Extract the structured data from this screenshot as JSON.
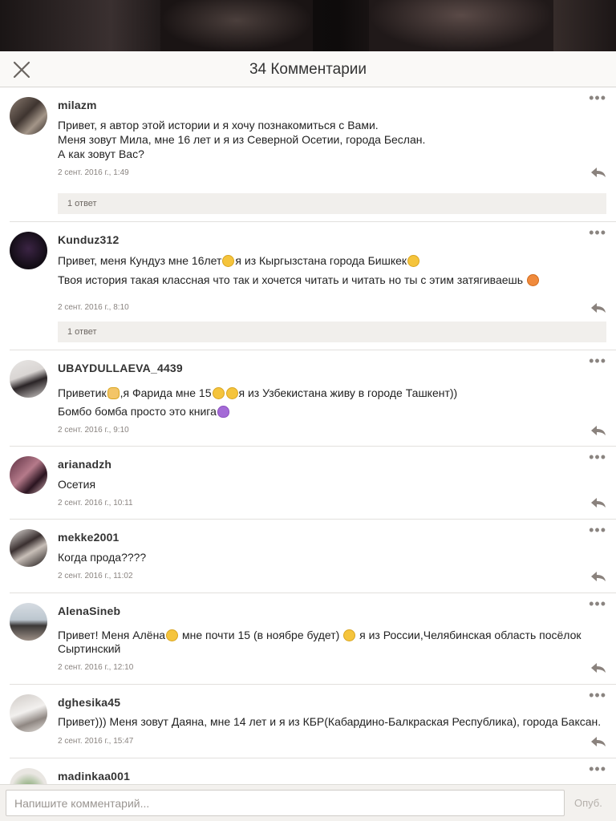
{
  "header": {
    "title": "34 Комментарии"
  },
  "comments": [
    {
      "author": "milazm",
      "lines": [
        "Привет, я автор этой истории и я хочу познакомиться с Вами.",
        "Меня зовут Мила, мне 16 лет и я из Северной Осетии, города Беслан.",
        "А как зовут Вас?"
      ],
      "timestamp": "2 сент. 2016 г., 1:49",
      "replies": "1 ответ"
    },
    {
      "author": "Kunduz312",
      "line1_a": "Привет, меня  Кундуз мне 16лет",
      "line1_b": "я из Кыргызстана города  Бишкек",
      "line2": "Твоя история  такая классная  что так и хочется  читать и читать но ты с этим затягиваешь",
      "timestamp": "2 сент. 2016 г., 8:10",
      "replies": "1 ответ"
    },
    {
      "author": "UBAYDULLAEVA_4439",
      "line1_a": "Приветик",
      "line1_b": ",я Фарида мне 15",
      "line1_c": "я из Узбекистана живу в городе Ташкент))",
      "line2": "Бомбо бомба просто это книга",
      "timestamp": "2 сент. 2016 г., 9:10"
    },
    {
      "author": "arianadzh",
      "text": "Осетия",
      "timestamp": "2 сент. 2016 г., 10:11"
    },
    {
      "author": "mekke2001",
      "text": "Когда прода????",
      "timestamp": "2 сент. 2016 г., 11:02"
    },
    {
      "author": "AlenaSineb",
      "line1_a": "Привет! Меня Алёна",
      "line1_b": " мне  почти 15 (в ноябре будет) ",
      "line1_c": " я из России,Челябинская область посёлок",
      "line2": "Сыртинский",
      "timestamp": "2 сент. 2016 г., 12:10"
    },
    {
      "author": "dghesika45",
      "text": "Привет))) Меня зовут Даяна, мне 14 лет и я из КБР(Кабардино-Балкраская Республика), города Баксан.",
      "timestamp": "2 сент. 2016 г., 15:47"
    },
    {
      "author": "madinkaa001"
    }
  ],
  "footer": {
    "placeholder": "Напишите комментарий...",
    "publish_label": "Опуб."
  }
}
